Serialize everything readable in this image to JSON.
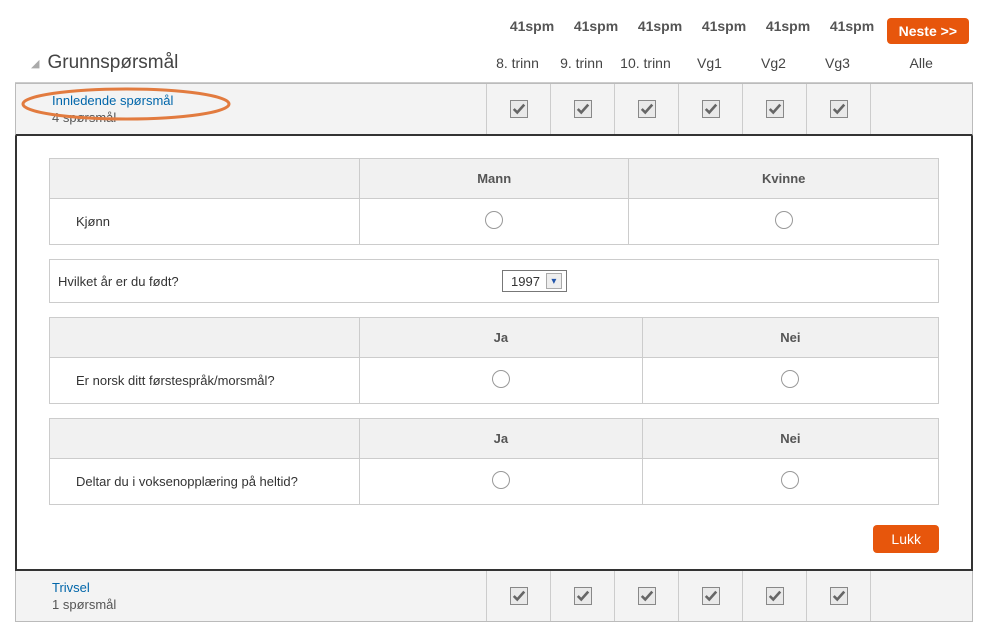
{
  "top": {
    "spm": [
      "41spm",
      "41spm",
      "41spm",
      "41spm",
      "41spm",
      "41spm"
    ],
    "next": "Neste >>"
  },
  "header": {
    "title": "Grunnspørsmål",
    "cols": [
      "8. trinn",
      "9. trinn",
      "10. trinn",
      "Vg1",
      "Vg2",
      "Vg3"
    ],
    "alle": "Alle"
  },
  "section1": {
    "title": "Innledende spørsmål",
    "sub": "4 spørsmål"
  },
  "section2": {
    "title": "Trivsel",
    "sub": "1 spørsmål"
  },
  "panel": {
    "mannkvinne": {
      "h1": "Mann",
      "h2": "Kvinne",
      "q": "Kjønn"
    },
    "year": {
      "q": "Hvilket år er du født?",
      "value": "1997"
    },
    "janei1": {
      "h1": "Ja",
      "h2": "Nei",
      "q": "Er norsk ditt førstespråk/morsmål?"
    },
    "janei2": {
      "h1": "Ja",
      "h2": "Nei",
      "q": "Deltar du i voksenopplæring på heltid?"
    },
    "close": "Lukk"
  }
}
